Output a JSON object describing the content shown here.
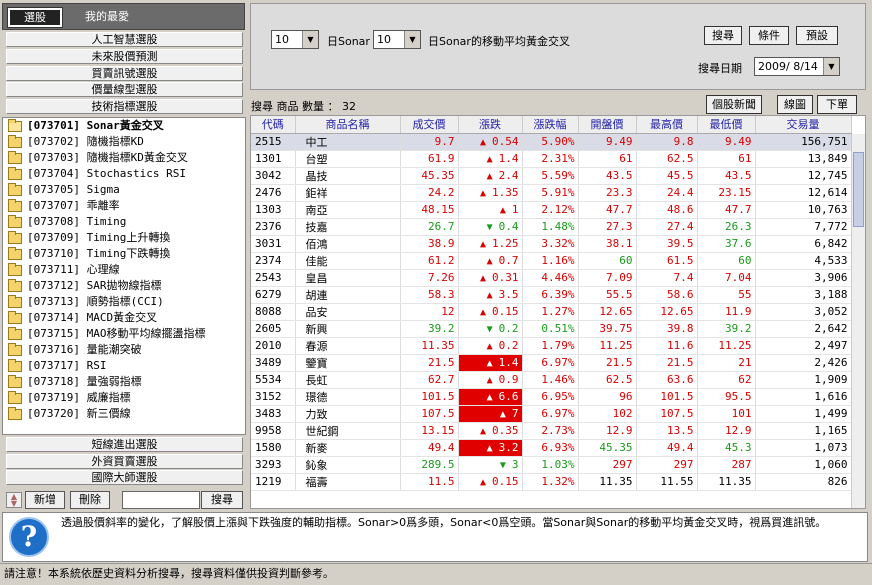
{
  "tabs": [
    {
      "label": "選股",
      "active": true
    },
    {
      "label": "我的最愛",
      "active": false
    }
  ],
  "categories_top": [
    "人工智慧選股",
    "未來股價預測",
    "買賣訊號選股",
    "價量線型選股",
    "技術指標選股"
  ],
  "tree": [
    {
      "label": "[073701] Sonar黃金交叉",
      "selected": true
    },
    {
      "label": "[073702] 隨機指標KD"
    },
    {
      "label": "[073703] 隨機指標KD黃金交叉"
    },
    {
      "label": "[073704] Stochastics RSI"
    },
    {
      "label": "[073705] Sigma"
    },
    {
      "label": "[073707] 乖離率"
    },
    {
      "label": "[073708] Timing"
    },
    {
      "label": "[073709] Timing上升轉換"
    },
    {
      "label": "[073710] Timing下跌轉換"
    },
    {
      "label": "[073711] 心理線"
    },
    {
      "label": "[073712] SAR拋物線指標"
    },
    {
      "label": "[073713] 順勢指標(CCI)"
    },
    {
      "label": "[073714] MACD黃金交叉"
    },
    {
      "label": "[073715] MAO移動平均線擺盪指標"
    },
    {
      "label": "[073716] 量能潮突破"
    },
    {
      "label": "[073717] RSI"
    },
    {
      "label": "[073718] 量強弱指標"
    },
    {
      "label": "[073719] 威廉指標"
    },
    {
      "label": "[073720] 新三價線"
    }
  ],
  "categories_bottom": [
    "短線進出選股",
    "外資買賣選股",
    "國際大師選股"
  ],
  "left_buttons": {
    "add": "新增",
    "delete": "刪除",
    "search": "搜尋"
  },
  "params": {
    "select1": "10",
    "text1": "日Sonar",
    "select2": "10",
    "text2": "日Sonar的移動平均黃金交叉",
    "search_btn": "搜尋",
    "condition_btn": "條件",
    "default_btn": "預設",
    "date_label": "搜尋日期",
    "date_value": "2009/ 8/14"
  },
  "result": {
    "label": "搜尋 商品 數量 ： 32",
    "news_btn": "個股新聞",
    "chart_btn": "線圖",
    "order_btn": "下單"
  },
  "columns": [
    "代碼",
    "商品名稱",
    "成交價",
    "漲跌",
    "漲跌幅",
    "開盤價",
    "最高價",
    "最低價",
    "交易量"
  ],
  "rows": [
    {
      "code": "2515",
      "name": "中工",
      "price": "9.7",
      "chg": "0.54",
      "pct": "5.90%",
      "open": "9.49",
      "high": "9.8",
      "low": "9.49",
      "vol": "156,751",
      "dir": "up",
      "limit": false,
      "open_c": "up",
      "high_c": "up",
      "low_c": "up",
      "selected": true
    },
    {
      "code": "1301",
      "name": "台塑",
      "price": "61.9",
      "chg": "1.4",
      "pct": "2.31%",
      "open": "61",
      "high": "62.5",
      "low": "61",
      "vol": "13,849",
      "dir": "up",
      "limit": false,
      "open_c": "up",
      "high_c": "up",
      "low_c": "up"
    },
    {
      "code": "3042",
      "name": "晶技",
      "price": "45.35",
      "chg": "2.4",
      "pct": "5.59%",
      "open": "43.5",
      "high": "45.5",
      "low": "43.5",
      "vol": "12,745",
      "dir": "up",
      "limit": false,
      "open_c": "up",
      "high_c": "up",
      "low_c": "up"
    },
    {
      "code": "2476",
      "name": "鉅祥",
      "price": "24.2",
      "chg": "1.35",
      "pct": "5.91%",
      "open": "23.3",
      "high": "24.4",
      "low": "23.15",
      "vol": "12,614",
      "dir": "up",
      "limit": false,
      "open_c": "up",
      "high_c": "up",
      "low_c": "up"
    },
    {
      "code": "1303",
      "name": "南亞",
      "price": "48.15",
      "chg": "1",
      "pct": "2.12%",
      "open": "47.7",
      "high": "48.6",
      "low": "47.7",
      "vol": "10,763",
      "dir": "up",
      "limit": false,
      "open_c": "up",
      "high_c": "up",
      "low_c": "up"
    },
    {
      "code": "2376",
      "name": "技嘉",
      "price": "26.7",
      "chg": "0.4",
      "pct": "1.48%",
      "open": "27.3",
      "high": "27.4",
      "low": "26.3",
      "vol": "7,772",
      "dir": "dn",
      "limit": false,
      "open_c": "up",
      "high_c": "up",
      "low_c": "dn"
    },
    {
      "code": "3031",
      "name": "佰鴻",
      "price": "38.9",
      "chg": "1.25",
      "pct": "3.32%",
      "open": "38.1",
      "high": "39.5",
      "low": "37.6",
      "vol": "6,842",
      "dir": "up",
      "limit": false,
      "open_c": "up",
      "high_c": "up",
      "low_c": "dn"
    },
    {
      "code": "2374",
      "name": "佳能",
      "price": "61.2",
      "chg": "0.7",
      "pct": "1.16%",
      "open": "60",
      "high": "61.5",
      "low": "60",
      "vol": "4,533",
      "dir": "up",
      "limit": false,
      "open_c": "dn",
      "high_c": "up",
      "low_c": "dn"
    },
    {
      "code": "2543",
      "name": "皇昌",
      "price": "7.26",
      "chg": "0.31",
      "pct": "4.46%",
      "open": "7.09",
      "high": "7.4",
      "low": "7.04",
      "vol": "3,906",
      "dir": "up",
      "limit": false,
      "open_c": "up",
      "high_c": "up",
      "low_c": "up"
    },
    {
      "code": "6279",
      "name": "胡連",
      "price": "58.3",
      "chg": "3.5",
      "pct": "6.39%",
      "open": "55.5",
      "high": "58.6",
      "low": "55",
      "vol": "3,188",
      "dir": "up",
      "limit": false,
      "open_c": "up",
      "high_c": "up",
      "low_c": "up"
    },
    {
      "code": "8088",
      "name": "品安",
      "price": "12",
      "chg": "0.15",
      "pct": "1.27%",
      "open": "12.65",
      "high": "12.65",
      "low": "11.9",
      "vol": "3,052",
      "dir": "up",
      "limit": false,
      "open_c": "up",
      "high_c": "up",
      "low_c": "up"
    },
    {
      "code": "2605",
      "name": "新興",
      "price": "39.2",
      "chg": "0.2",
      "pct": "0.51%",
      "open": "39.75",
      "high": "39.8",
      "low": "39.2",
      "vol": "2,642",
      "dir": "dn",
      "limit": false,
      "open_c": "up",
      "high_c": "up",
      "low_c": "dn"
    },
    {
      "code": "2010",
      "name": "春源",
      "price": "11.35",
      "chg": "0.2",
      "pct": "1.79%",
      "open": "11.25",
      "high": "11.6",
      "low": "11.25",
      "vol": "2,497",
      "dir": "up",
      "limit": false,
      "open_c": "up",
      "high_c": "up",
      "low_c": "up"
    },
    {
      "code": "3489",
      "name": "鑒寶",
      "price": "21.5",
      "chg": "1.4",
      "pct": "6.97%",
      "open": "21.5",
      "high": "21.5",
      "low": "21",
      "vol": "2,426",
      "dir": "up",
      "limit": true,
      "open_c": "up",
      "high_c": "up",
      "low_c": "up"
    },
    {
      "code": "5534",
      "name": "長虹",
      "price": "62.7",
      "chg": "0.9",
      "pct": "1.46%",
      "open": "62.5",
      "high": "63.6",
      "low": "62",
      "vol": "1,909",
      "dir": "up",
      "limit": false,
      "open_c": "up",
      "high_c": "up",
      "low_c": "up"
    },
    {
      "code": "3152",
      "name": "璟德",
      "price": "101.5",
      "chg": "6.6",
      "pct": "6.95%",
      "open": "96",
      "high": "101.5",
      "low": "95.5",
      "vol": "1,616",
      "dir": "up",
      "limit": true,
      "open_c": "up",
      "high_c": "up",
      "low_c": "up"
    },
    {
      "code": "3483",
      "name": "力致",
      "price": "107.5",
      "chg": "7",
      "pct": "6.97%",
      "open": "102",
      "high": "107.5",
      "low": "101",
      "vol": "1,499",
      "dir": "up",
      "limit": true,
      "open_c": "up",
      "high_c": "up",
      "low_c": "up"
    },
    {
      "code": "9958",
      "name": "世紀鋼",
      "price": "13.15",
      "chg": "0.35",
      "pct": "2.73%",
      "open": "12.9",
      "high": "13.5",
      "low": "12.9",
      "vol": "1,165",
      "dir": "up",
      "limit": false,
      "open_c": "up",
      "high_c": "up",
      "low_c": "up"
    },
    {
      "code": "1580",
      "name": "新麥",
      "price": "49.4",
      "chg": "3.2",
      "pct": "6.93%",
      "open": "45.35",
      "high": "49.4",
      "low": "45.3",
      "vol": "1,073",
      "dir": "up",
      "limit": true,
      "open_c": "dn",
      "high_c": "up",
      "low_c": "dn"
    },
    {
      "code": "3293",
      "name": "鈊象",
      "price": "289.5",
      "chg": "3",
      "pct": "1.03%",
      "open": "297",
      "high": "297",
      "low": "287",
      "vol": "1,060",
      "dir": "dn",
      "limit": false,
      "open_c": "up",
      "high_c": "up",
      "low_c": "up"
    },
    {
      "code": "1219",
      "name": "福壽",
      "price": "11.5",
      "chg": "0.15",
      "pct": "1.32%",
      "open": "11.35",
      "high": "11.55",
      "low": "11.35",
      "vol": "826",
      "dir": "up",
      "limit": false,
      "open_c": "flat",
      "high_c": "flat",
      "low_c": "flat"
    }
  ],
  "description": "透過股價斜率的變化，了解股價上漲與下跌強度的輔助指標。Sonar>0爲多頭，Sonar<0爲空頭。當Sonar與Sonar的移動平均黃金交叉時，視爲買進訊號。",
  "status": "請注意！本系統依歷史資料分析搜尋，搜尋資料僅供投資判斷參考。",
  "colors": {
    "up": "#d80000",
    "down": "#1a9a1a",
    "limit_bg": "#e00000",
    "selected_row": "#d9dce6",
    "header_text": "#2222aa"
  }
}
